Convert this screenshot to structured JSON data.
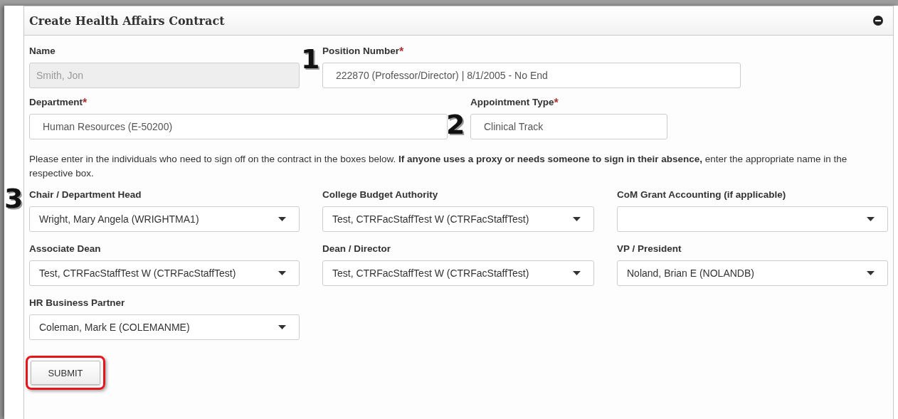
{
  "panel": {
    "title": "Create Health Affairs Contract"
  },
  "field_rows": [
    [
      {
        "label": "Name",
        "value": "Smith, Jon",
        "disabled": true
      },
      {
        "label": "Position Number",
        "required_mark": "*",
        "value": "222870 (Professor/Director) | 8/1/2005 - No End",
        "disabled": false,
        "callout": "1"
      }
    ],
    [
      {
        "label": "Department",
        "required_mark": "*",
        "value": "Human Resources (E-50200)",
        "disabled": false
      },
      {
        "label": "Appointment Type",
        "required_mark": "*",
        "value": "Clinical Track",
        "disabled": false,
        "callout": "2"
      }
    ]
  ],
  "instructions": "Please enter in the individuals who need to sign off on the contract in the boxes below. **If anyone uses a proxy or needs someone to sign in their absence,** enter the appropriate name in the respective box.",
  "signers": [
    {
      "label": "Chair / Department Head",
      "value": "Wright, Mary Angela (WRIGHTMA1)",
      "callout": "3"
    },
    {
      "label": "College Budget Authority",
      "value": "Test, CTRFacStaffTest W (CTRFacStaffTest)"
    },
    {
      "label": "CoM Grant Accounting (if applicable)"
    },
    {
      "label": "Associate Dean",
      "value": "Test, CTRFacStaffTest W (CTRFacStaffTest)"
    },
    {
      "label": "Dean / Director",
      "value": "Test, CTRFacStaffTest W (CTRFacStaffTest)"
    },
    {
      "label": "VP / President",
      "value": "Noland, Brian E (NOLANDB)"
    },
    {
      "label": "HR Business Partner",
      "value": "Coleman, Mark E (COLEMANME)"
    }
  ],
  "submit": {
    "label": "SUBMIT",
    "highlighted": true
  }
}
